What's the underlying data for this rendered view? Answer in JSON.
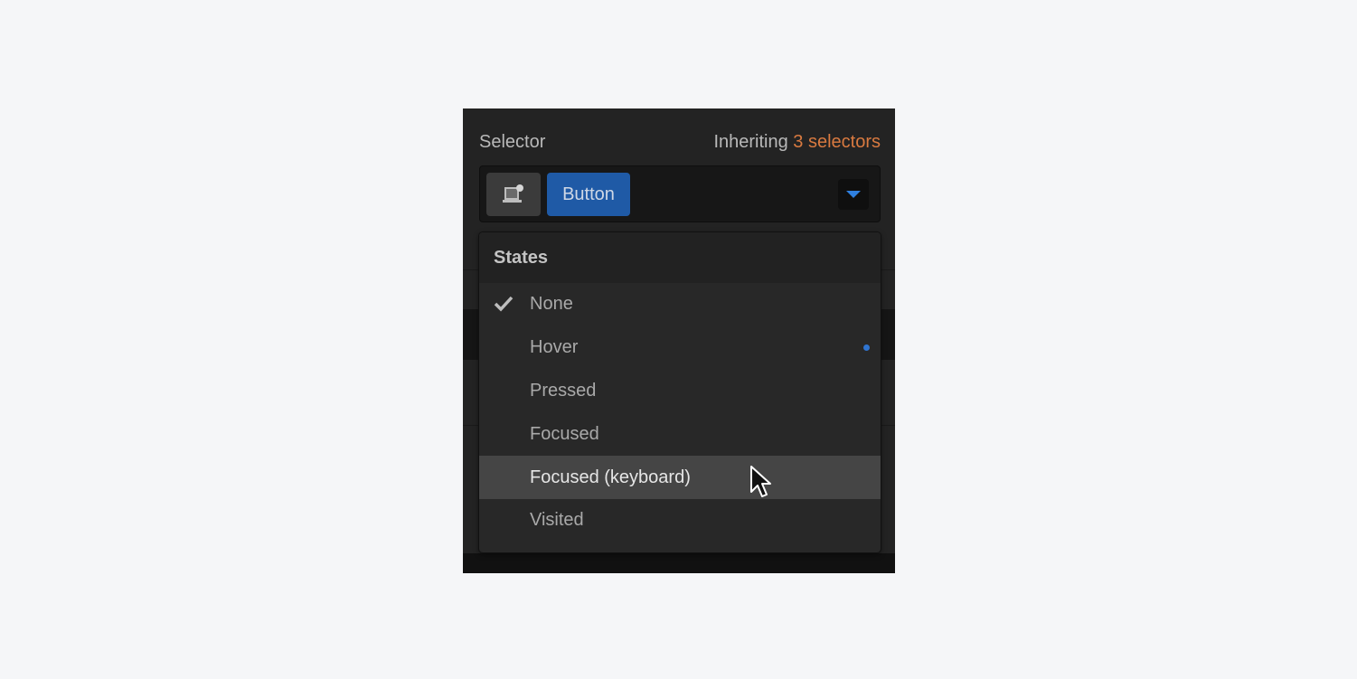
{
  "selector_panel": {
    "label": "Selector",
    "inheriting_prefix": "Inheriting",
    "inheriting_count_text": "3 selectors",
    "accent_color": "#d97a40",
    "element_icon": "element-type-icon",
    "selected_tag": "Button",
    "tag_color": "#1f5aa6",
    "dropdown_icon": "caret-down-icon"
  },
  "states_menu": {
    "title": "States",
    "items": [
      {
        "label": "None",
        "checked": true,
        "has_styles_dot": false,
        "highlighted": false
      },
      {
        "label": "Hover",
        "checked": false,
        "has_styles_dot": true,
        "highlighted": false
      },
      {
        "label": "Pressed",
        "checked": false,
        "has_styles_dot": false,
        "highlighted": false
      },
      {
        "label": "Focused",
        "checked": false,
        "has_styles_dot": false,
        "highlighted": false
      },
      {
        "label": "Focused (keyboard)",
        "checked": false,
        "has_styles_dot": false,
        "highlighted": true
      },
      {
        "label": "Visited",
        "checked": false,
        "has_styles_dot": false,
        "highlighted": false
      }
    ],
    "dot_color": "#2f74d0"
  }
}
